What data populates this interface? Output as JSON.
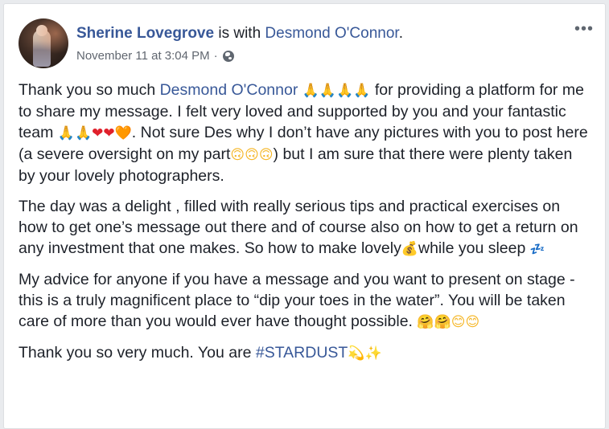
{
  "post": {
    "author": "Sherine Lovegrove",
    "with_text": "is with",
    "tagged": "Desmond O'Connor",
    "tagged_suffix": ".",
    "timestamp": "November 11 at 3:04 PM",
    "meta_separator": "·",
    "privacy_icon": "globe-icon",
    "more_label": "•••"
  },
  "body": {
    "p1": {
      "t1": "Thank you so much ",
      "mention": "Desmond O'Connor",
      "e1": " 🙏🙏🙏🙏 ",
      "t2": "for providing a platform for me to share my message. I felt very loved and supported by you and your fantastic team ",
      "e2a": "🙏🙏",
      "e2b": "❤❤",
      "e2c": "🧡",
      "t3": ". Not sure Des why I don’t have any pictures with you to post here (a severe oversight on my part",
      "e3": "🙃🙃🙃",
      "t4": ") but I am sure that there were plenty taken by your lovely photographers."
    },
    "p2": {
      "t1": "The day was a delight , filled with really serious tips and practical exercises on how to get one’s message out there and of course also on how to get a return on any investment that one makes. So how to make lovely",
      "e1": "💰",
      "t2": "while you sleep ",
      "e2": "💤"
    },
    "p3": {
      "t1": "My advice for anyone if you have a message and you want to present on stage - this is a truly magnificent place to “dip your toes in the water”. You will be taken care of more than you would ever have thought possible. ",
      "e1": "🤗🤗",
      "e2": "😊😊"
    },
    "p4": {
      "t1": "Thank you so very much. You are ",
      "hashtag": "#STARDUST",
      "e1": "💫",
      "e2": "✨"
    }
  }
}
